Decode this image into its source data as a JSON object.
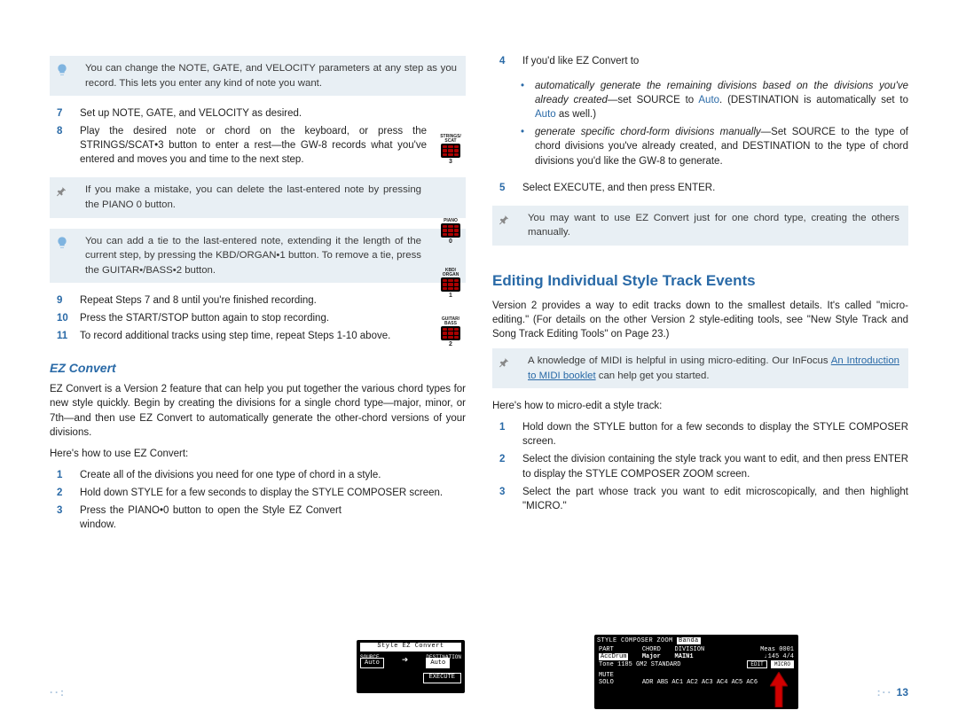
{
  "page_number": "13",
  "tips": {
    "t1": "You can change the NOTE, GATE, and VELOCITY parameters at any step as you record. This lets you enter any kind of note you want.",
    "t2": "If you make a mistake, you can delete the last-entered note by pressing the PIANO 0 button.",
    "t3": "You can add a tie to the last-entered note, extending it the length of the current step, by pressing the KBD/ORGAN•1 button. To remove a tie, press the GUITAR•/BASS•2 button.",
    "t4": "You may want to use EZ Convert just for one chord type, creating the others manually.",
    "t5_a": "A knowledge of MIDI is helpful in using micro-editing. Our InFocus ",
    "t5_link": "An Introduction to MIDI booklet",
    "t5_b": " can help get you started."
  },
  "left_steps_a": {
    "7": "Set up NOTE, GATE, and VELOCITY as desired.",
    "8": "Play the desired note or chord on the keyboard, or press the STRINGS/SCAT•3 button to enter a rest—the GW-8 records what you've entered and moves you and time to the next step."
  },
  "left_steps_b": {
    "9": "Repeat Steps 7 and 8 until you're finished recording.",
    "10": "Press the START/STOP button again to stop recording.",
    "11": "To record additional tracks using step time, repeat Steps 1-10 above."
  },
  "ez_heading": "EZ Convert",
  "ez_para": "EZ Convert is a Version 2 feature that can help you put together the various chord types for new style quickly. Begin by creating the divisions for a single chord type—major, minor, or 7th—and then use EZ Convert to automatically generate the other-chord versions of your divisions.",
  "ez_howto": "Here's how to use EZ Convert:",
  "ez_steps": {
    "1": "Create all of the divisions you need for one type of chord in a style.",
    "2": "Hold down STYLE for a few seconds to display the STYLE COMPOSER screen.",
    "3": "Press the PIANO•0 button to open the Style EZ Convert window."
  },
  "right_step4_lead": "If you'd like EZ Convert to",
  "right_sub": {
    "a_pre": "automatically generate the remaining divisions based on the divisions you've already created",
    "a_post": "—set SOURCE to ",
    "a_auto": "Auto",
    "a_tail": ". (DESTINATION is automatically set to ",
    "a_auto2": "Auto",
    "a_end": " as well.)",
    "b_pre": "generate specific chord-form divisions manually",
    "b_post": "—Set SOURCE to the type of chord divisions you've already created, and DESTINATION to the type of chord divisions you'd like the GW-8 to generate."
  },
  "right_step5": "Select EXECUTE, and then press ENTER.",
  "ed_heading": "Editing Individual Style Track Events",
  "ed_para": "Version 2 provides a way to edit tracks down to the smallest details. It's called \"micro-editing.\" (For details on the other Version 2 style-editing tools, see \"New Style Track and Song Track Editing Tools\" on Page 23.)",
  "micro_howto": "Here's how to micro-edit a style track:",
  "micro_steps": {
    "1": "Hold down the STYLE button for a few seconds to display the STYLE COMPOSER screen.",
    "2": "Select the division containing the style track you want to edit, and then press ENTER to display the STYLE COMPOSER ZOOM screen.",
    "3": "Select the part whose track you want to edit microscopically, and then highlight \"MICRO.\""
  },
  "btnstrip": {
    "b3": {
      "label": "STRINGS/\nSCAT",
      "num": "3"
    },
    "b0": {
      "label": "PIANO",
      "num": "0"
    },
    "b1": {
      "label": "KBD/\nORGAN",
      "num": "1"
    },
    "b2": {
      "label": "GUITAR/\nBASS",
      "num": "2"
    }
  },
  "lcd1": {
    "title": "Style EZ Convert",
    "source_lbl": "SOURCE",
    "dest_lbl": "DESTINATION",
    "auto": "Auto",
    "exec": "EXECUTE"
  },
  "lcd2": {
    "hdr_a": "STYLE COMPOSER ZOOM",
    "hdr_b": "Banda",
    "row_part_l": "PART",
    "row_part": "AccDrum",
    "row_chord_l": "CHORD",
    "row_chord": "Major",
    "row_div_l": "DIVISION",
    "row_div": "MAIN1",
    "row_meas_l": "Meas",
    "row_meas": "0001",
    "tone": "Tone  1185  GM2 STANDARD",
    "tempo": "♩145 4/4",
    "edit": "EDIT",
    "micro": "MICRO",
    "mute": "MUTE",
    "solo": "SOLO",
    "tracks": "ADR  ABS AC1 AC2 AC3 AC4 AC5 AC6"
  }
}
